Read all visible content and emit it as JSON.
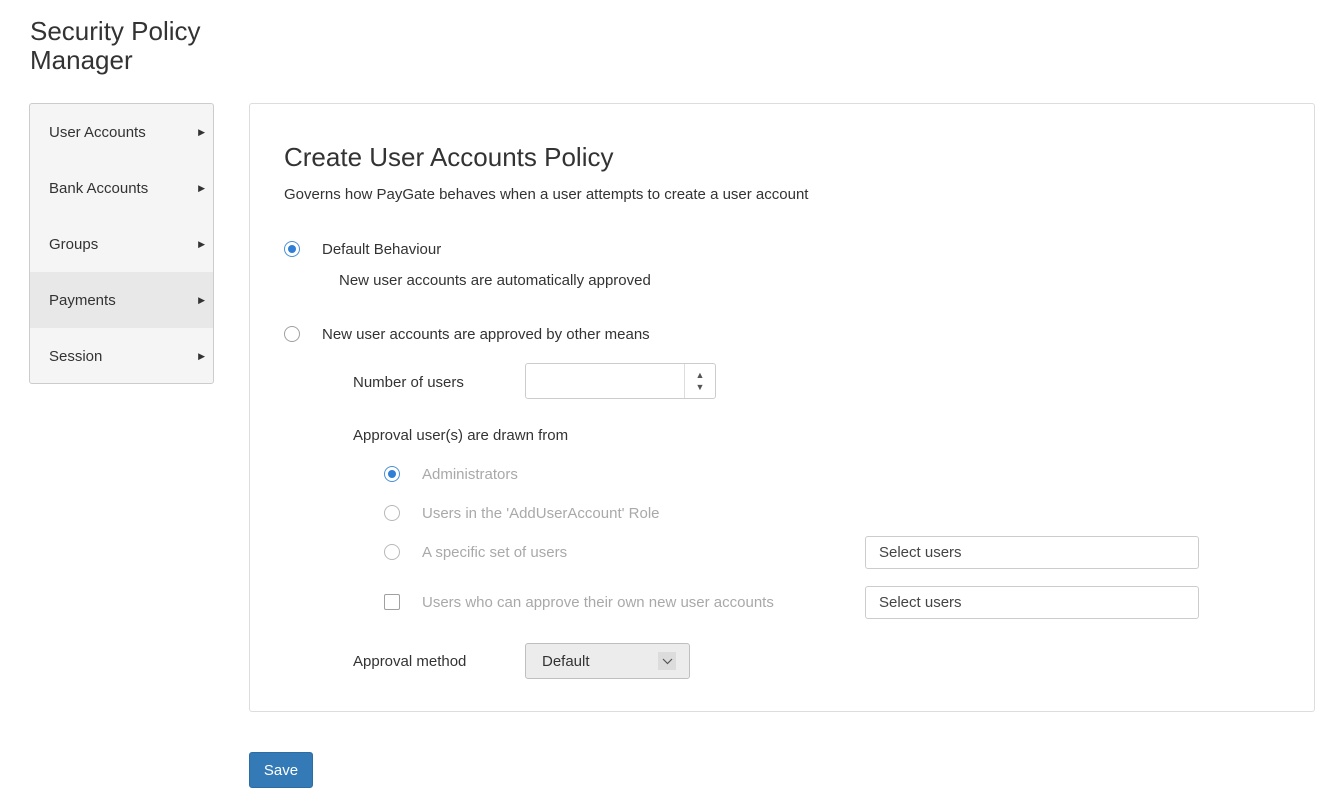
{
  "app": {
    "title": "Security Policy Manager"
  },
  "sidebar": {
    "items": [
      {
        "label": "User Accounts"
      },
      {
        "label": "Bank Accounts"
      },
      {
        "label": "Groups"
      },
      {
        "label": "Payments"
      },
      {
        "label": "Session"
      }
    ]
  },
  "policy": {
    "title": "Create User Accounts Policy",
    "description": "Governs how PayGate behaves when a user attempts to create a user account",
    "default_option": {
      "label": "Default Behaviour",
      "note": "New user accounts are automatically approved",
      "selected": true
    },
    "other_option": {
      "label": "New user accounts are approved by other means",
      "selected": false
    },
    "number_of_users": {
      "label": "Number of users",
      "value": ""
    },
    "approval_source": {
      "label": "Approval user(s) are drawn from",
      "options": [
        {
          "label": "Administrators",
          "selected": true
        },
        {
          "label": "Users in the 'AddUserAccount' Role",
          "selected": false
        },
        {
          "label": "A specific set of users",
          "selected": false
        }
      ],
      "specific_users_placeholder": "Select users"
    },
    "self_approval": {
      "label": "Users who can approve their own new user accounts",
      "checked": false,
      "placeholder": "Select users"
    },
    "approval_method": {
      "label": "Approval method",
      "value": "Default"
    }
  },
  "actions": {
    "save_label": "Save"
  },
  "colors": {
    "primary": "#337ab7",
    "radio_checked": "#2f7fd6"
  }
}
